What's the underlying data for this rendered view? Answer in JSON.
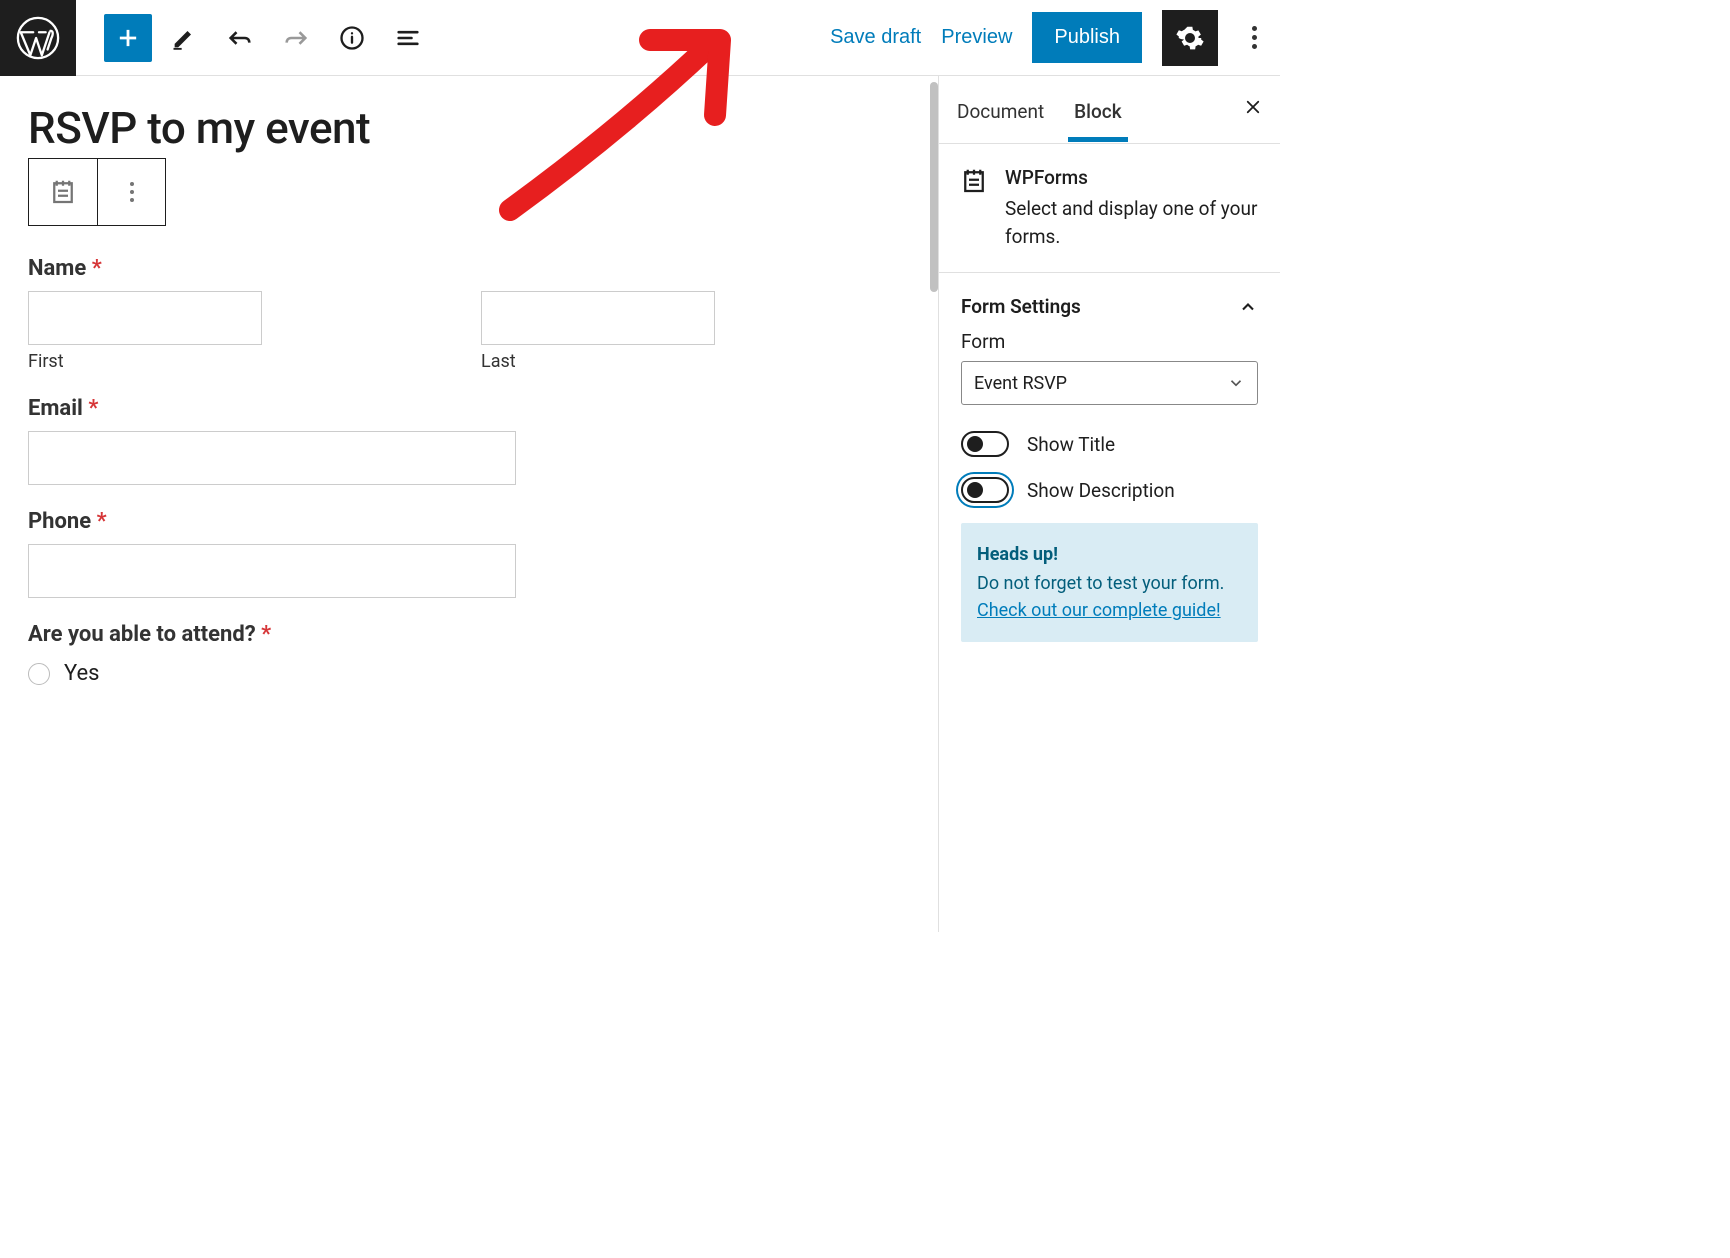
{
  "toolbar": {
    "save_draft": "Save draft",
    "preview": "Preview",
    "publish": "Publish"
  },
  "editor": {
    "title": "RSVP to my event",
    "fields": {
      "name_label": "Name",
      "name_first_sub": "First",
      "name_last_sub": "Last",
      "email_label": "Email",
      "phone_label": "Phone",
      "attend_label": "Are you able to attend?",
      "attend_option_yes": "Yes"
    }
  },
  "sidebar": {
    "tab_document": "Document",
    "tab_block": "Block",
    "block_name": "WPForms",
    "block_desc": "Select and display one of your forms.",
    "panel_title": "Form Settings",
    "form_label": "Form",
    "form_selected": "Event RSVP",
    "toggle_show_title": "Show Title",
    "toggle_show_description": "Show Description",
    "notice_title": "Heads up!",
    "notice_text": "Do not forget to test your form.",
    "notice_link": "Check out our complete guide!"
  }
}
